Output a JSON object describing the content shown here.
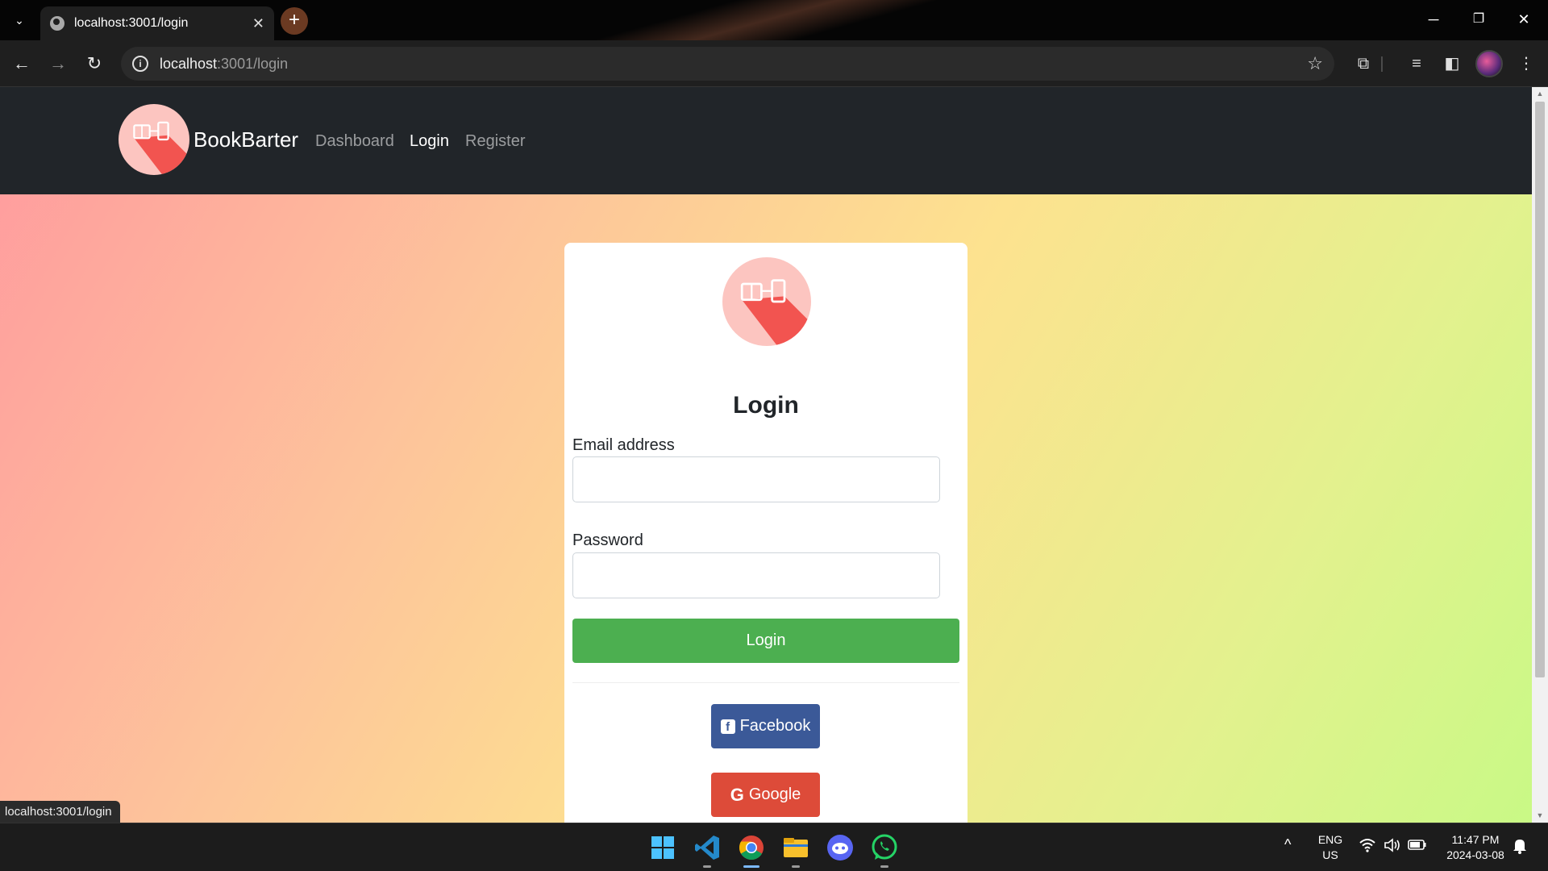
{
  "browser": {
    "tab_title": "localhost:3001/login",
    "tab_close": "✕",
    "new_tab": "+",
    "tab_menu": "⌄",
    "window_controls": {
      "minimize": "─",
      "restore": "❐",
      "close": "✕"
    },
    "url_host": "localhost",
    "url_path": ":3001/login",
    "status_url": "localhost:3001/login"
  },
  "site": {
    "brand": "BookBarter",
    "nav": [
      {
        "label": "Dashboard",
        "active": false
      },
      {
        "label": "Login",
        "active": true
      },
      {
        "label": "Register",
        "active": false
      }
    ]
  },
  "login_form": {
    "title": "Login",
    "email_label": "Email address",
    "email_value": "",
    "password_label": "Password",
    "password_value": "",
    "submit_label": "Login",
    "facebook_label": "Facebook",
    "google_label": "Google"
  },
  "colors": {
    "nav_bg": "#212529",
    "login_button": "#4caf50",
    "facebook_button": "#3b5998",
    "google_button": "#dd4b39",
    "logo_circle": "#fcc5c0",
    "logo_shadow": "#f25450"
  },
  "taskbar": {
    "apps": [
      "windows-start-icon",
      "vscode-icon",
      "chrome-icon",
      "file-explorer-icon",
      "discord-icon",
      "whatsapp-icon"
    ],
    "lang_top": "ENG",
    "lang_bottom": "US",
    "time": "11:47 PM",
    "date": "2024-03-08"
  }
}
